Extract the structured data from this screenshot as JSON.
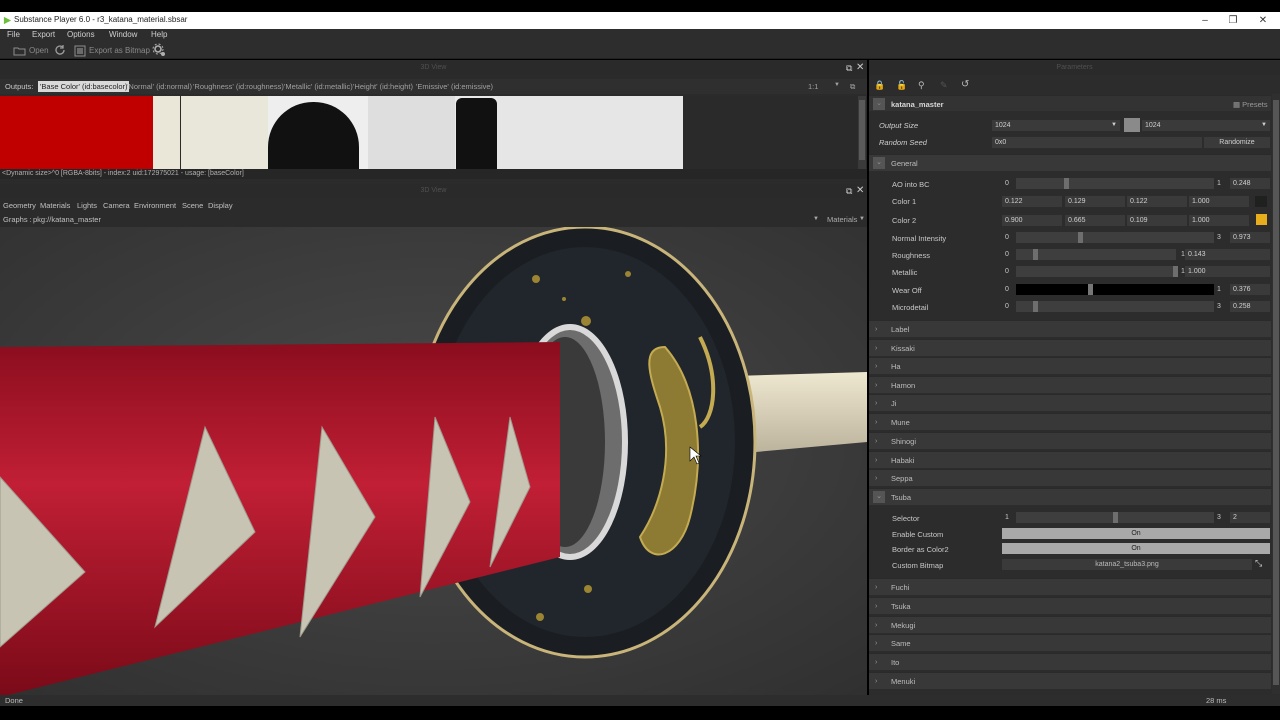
{
  "window": {
    "title": "Substance Player 6.0 - r3_katana_material.sbsar",
    "controls": [
      "–",
      "❐",
      "✕"
    ]
  },
  "menu": [
    "File",
    "Export",
    "Options",
    "Window",
    "Help"
  ],
  "toolbar": {
    "open_label": "Open",
    "export_label": "Export as Bitmap"
  },
  "outputs_panel": {
    "header": "3D View",
    "outputs_label": "Outputs:",
    "outputs": [
      "'Base Color' (id:basecolor)",
      "'Normal' (id:normal)",
      "'Roughness' (id:roughness)",
      "'Metallic' (id:metallic)",
      "'Height' (id:height)",
      "'Emissive' (id:emissive)"
    ],
    "zoom": "1:1",
    "info_line": "<Dynamic size>^0 [RGBA-8bits] - index:2 uid:172975021 - usage: [baseColor]"
  },
  "view3d_panel": {
    "header": "3D View",
    "menu": [
      "Geometry",
      "Materials",
      "Lights",
      "Camera",
      "Environment",
      "Scene",
      "Display"
    ],
    "graphs_label": "Graphs :",
    "graph_value": "pkg://katana_master",
    "materials_dropdown": "Materials"
  },
  "parameters": {
    "header": "Parameters",
    "graph_name": "katana_master",
    "presets_label": "Presets",
    "output_size_label": "Output Size",
    "output_size_a": "1024",
    "output_size_b": "1024",
    "random_seed_label": "Random Seed",
    "random_seed_value": "0x0",
    "randomize_label": "Randomize",
    "general_label": "General",
    "ao_label": "AO into BC",
    "ao_min": "0",
    "ao_max": "1",
    "ao_value": "0.248",
    "color1_label": "Color 1",
    "color1": [
      "0.122",
      "0.129",
      "0.122",
      "1.000"
    ],
    "color2_label": "Color 2",
    "color2": [
      "0.900",
      "0.665",
      "0.109",
      "1.000"
    ],
    "color2_swatch": "#e8ad1c",
    "normal_label": "Normal Intensity",
    "normal_min": "0",
    "normal_max": "3",
    "normal_value": "0.973",
    "rough_label": "Roughness",
    "rough_min": "0",
    "rough_max": "1",
    "rough_value": "0.143",
    "metal_label": "Metallic",
    "metal_min": "0",
    "metal_max": "1",
    "metal_value": "1.000",
    "wear_label": "Wear Off",
    "wear_min": "0",
    "wear_max": "1",
    "wear_value": "0.376",
    "micro_label": "Microdetail",
    "micro_min": "0",
    "micro_max": "3",
    "micro_value": "0.258",
    "sections_a": [
      "Label",
      "Kissaki",
      "Ha",
      "Hamon",
      "Ji",
      "Mune",
      "Shinogi",
      "Habaki",
      "Seppa"
    ],
    "tsuba_label": "Tsuba",
    "selector_label": "Selector",
    "selector_min": "1",
    "selector_max": "3",
    "selector_value": "2",
    "enable_custom_label": "Enable Custom",
    "enable_custom_value": "On",
    "border_label": "Border as Color2",
    "border_value": "On",
    "custom_bitmap_label": "Custom Bitmap",
    "custom_bitmap_value": "katana2_tsuba3.png",
    "sections_b": [
      "Fuchi",
      "Tsuka",
      "Mekugi",
      "Same",
      "Ito",
      "Menuki"
    ]
  },
  "status": {
    "left": "Done",
    "right": "28 ms"
  },
  "colors": {
    "accent_red": "#c00000",
    "panel_bg": "#2c2c2c"
  }
}
